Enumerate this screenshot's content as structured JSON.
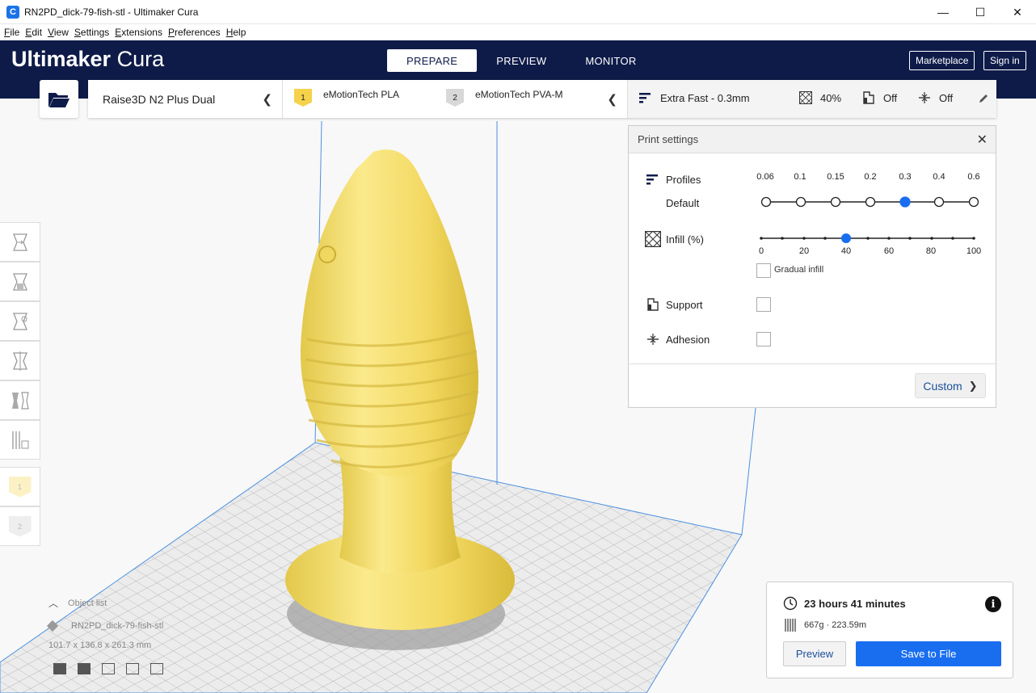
{
  "window": {
    "title": "RN2PD_dick-79-fish-stl - Ultimaker Cura",
    "app_icon": "C",
    "minimize": "—",
    "maximize": "☐",
    "close": "✕"
  },
  "menu": [
    "File",
    "Edit",
    "View",
    "Settings",
    "Extensions",
    "Preferences",
    "Help"
  ],
  "header": {
    "brand_bold": "Ultimaker",
    "brand_light": "Cura",
    "tabs": [
      {
        "label": "PREPARE",
        "active": true
      },
      {
        "label": "PREVIEW",
        "active": false
      },
      {
        "label": "MONITOR",
        "active": false
      }
    ],
    "marketplace": "Marketplace",
    "signin": "Sign in"
  },
  "config": {
    "printer": "Raise3D N2 Plus Dual",
    "extruders": [
      {
        "num": "1",
        "material": "eMotionTech PLA",
        "color": "#f5d24a"
      },
      {
        "num": "2",
        "material": "eMotionTech PVA-M",
        "color": "#d8d8d8"
      }
    ],
    "quality": "Extra Fast - 0.3mm",
    "infill": "40%",
    "support": "Off",
    "adhesion": "Off"
  },
  "print_settings": {
    "title": "Print settings",
    "close": "✕",
    "profiles_label": "Profiles",
    "default_label": "Default",
    "profile_values": [
      "0.06",
      "0.1",
      "0.15",
      "0.2",
      "0.3",
      "0.4",
      "0.6"
    ],
    "profile_selected": "0.3",
    "infill_label": "Infill (%)",
    "infill_ticks": [
      "0",
      "20",
      "40",
      "60",
      "80",
      "100"
    ],
    "infill_value": 40,
    "gradual_infill": "Gradual infill",
    "support_label": "Support",
    "adhesion_label": "Adhesion",
    "custom": "Custom"
  },
  "object_list": {
    "header": "Object list",
    "name": "RN2PD_dick-79-fish-stl",
    "dims": "101.7 x 136.8 x 261.3 mm"
  },
  "action": {
    "time": "23 hours 41 minutes",
    "material": "667g · 223.59m",
    "preview": "Preview",
    "save": "Save to File"
  },
  "colors": {
    "header_bg": "#0e1b49",
    "accent": "#196ef0",
    "model": "#f5e07a"
  }
}
